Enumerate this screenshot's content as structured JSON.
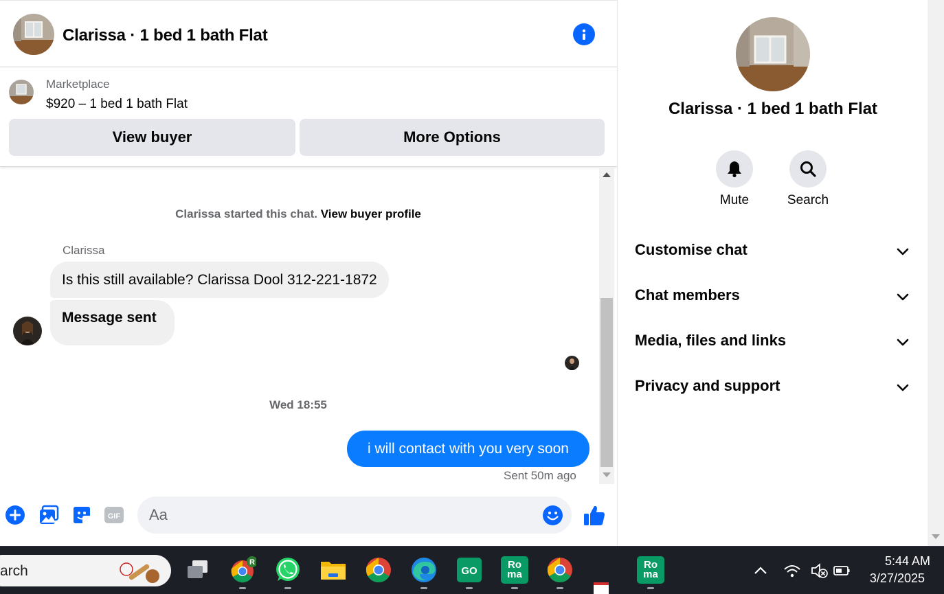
{
  "header": {
    "title": "Clarissa · 1 bed 1 bath Flat",
    "info_icon": "info-icon"
  },
  "listing": {
    "kind": "Marketplace",
    "price_title": "$920 – 1 bed 1 bath Flat",
    "view_buyer": "View buyer",
    "more_options": "More Options"
  },
  "conversation": {
    "system_text": "Clarissa started this chat.",
    "system_link": "View buyer profile",
    "sender_name": "Clarissa",
    "incoming": [
      "Is this still available? Clarissa Dool 312-221-1872",
      "Message sent"
    ],
    "timestamp": "Wed 18:55",
    "outgoing": "i will contact with you very soon",
    "sent_status": "Sent 50m ago"
  },
  "composer": {
    "placeholder": "Aa",
    "icons": [
      "plus-icon",
      "photo-icon",
      "sticker-icon",
      "gif-icon",
      "emoji-icon",
      "thumbs-up-icon"
    ],
    "gif_label": "GIF"
  },
  "info_pane": {
    "title": "Clarissa · 1 bed 1 bath Flat",
    "actions": [
      {
        "label": "Mute",
        "icon": "bell-icon"
      },
      {
        "label": "Search",
        "icon": "search-icon"
      }
    ],
    "sections": [
      "Customise chat",
      "Chat members",
      "Media, files and links",
      "Privacy and support"
    ]
  },
  "taskbar": {
    "search_text": "arch",
    "time": "5:44 AM",
    "date": "3/27/2025",
    "roma_label": [
      "Ro",
      "ma"
    ],
    "chrome_badge": "R",
    "meet_label": "GO"
  },
  "colors": {
    "accent": "#0866ff",
    "bubble_out": "#0a7cff",
    "bubble_in": "#f0f0f0",
    "button_bg": "#e4e6eb",
    "taskbar": "#1c1f26"
  }
}
